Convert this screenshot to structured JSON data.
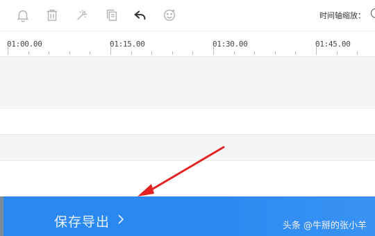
{
  "toolbar": {
    "icons": [
      "bell-icon",
      "trash-icon",
      "magic-wand-icon",
      "copy-icon",
      "undo-icon",
      "emoji-icon"
    ],
    "zoom_label": "时间轴缩放："
  },
  "ruler": {
    "labels": [
      "01:00.00",
      "01:15.00",
      "01:30.00",
      "01:45.00"
    ]
  },
  "export": {
    "label": "保存导出",
    "chevron_icon": "chevron-right-icon"
  },
  "annotation": {
    "arrow_color": "#e52222"
  },
  "watermark": {
    "text": "头条 @牛掰的张小羊"
  },
  "colors": {
    "accent": "#2a88ef",
    "track_alt": "#f5f5f5"
  }
}
